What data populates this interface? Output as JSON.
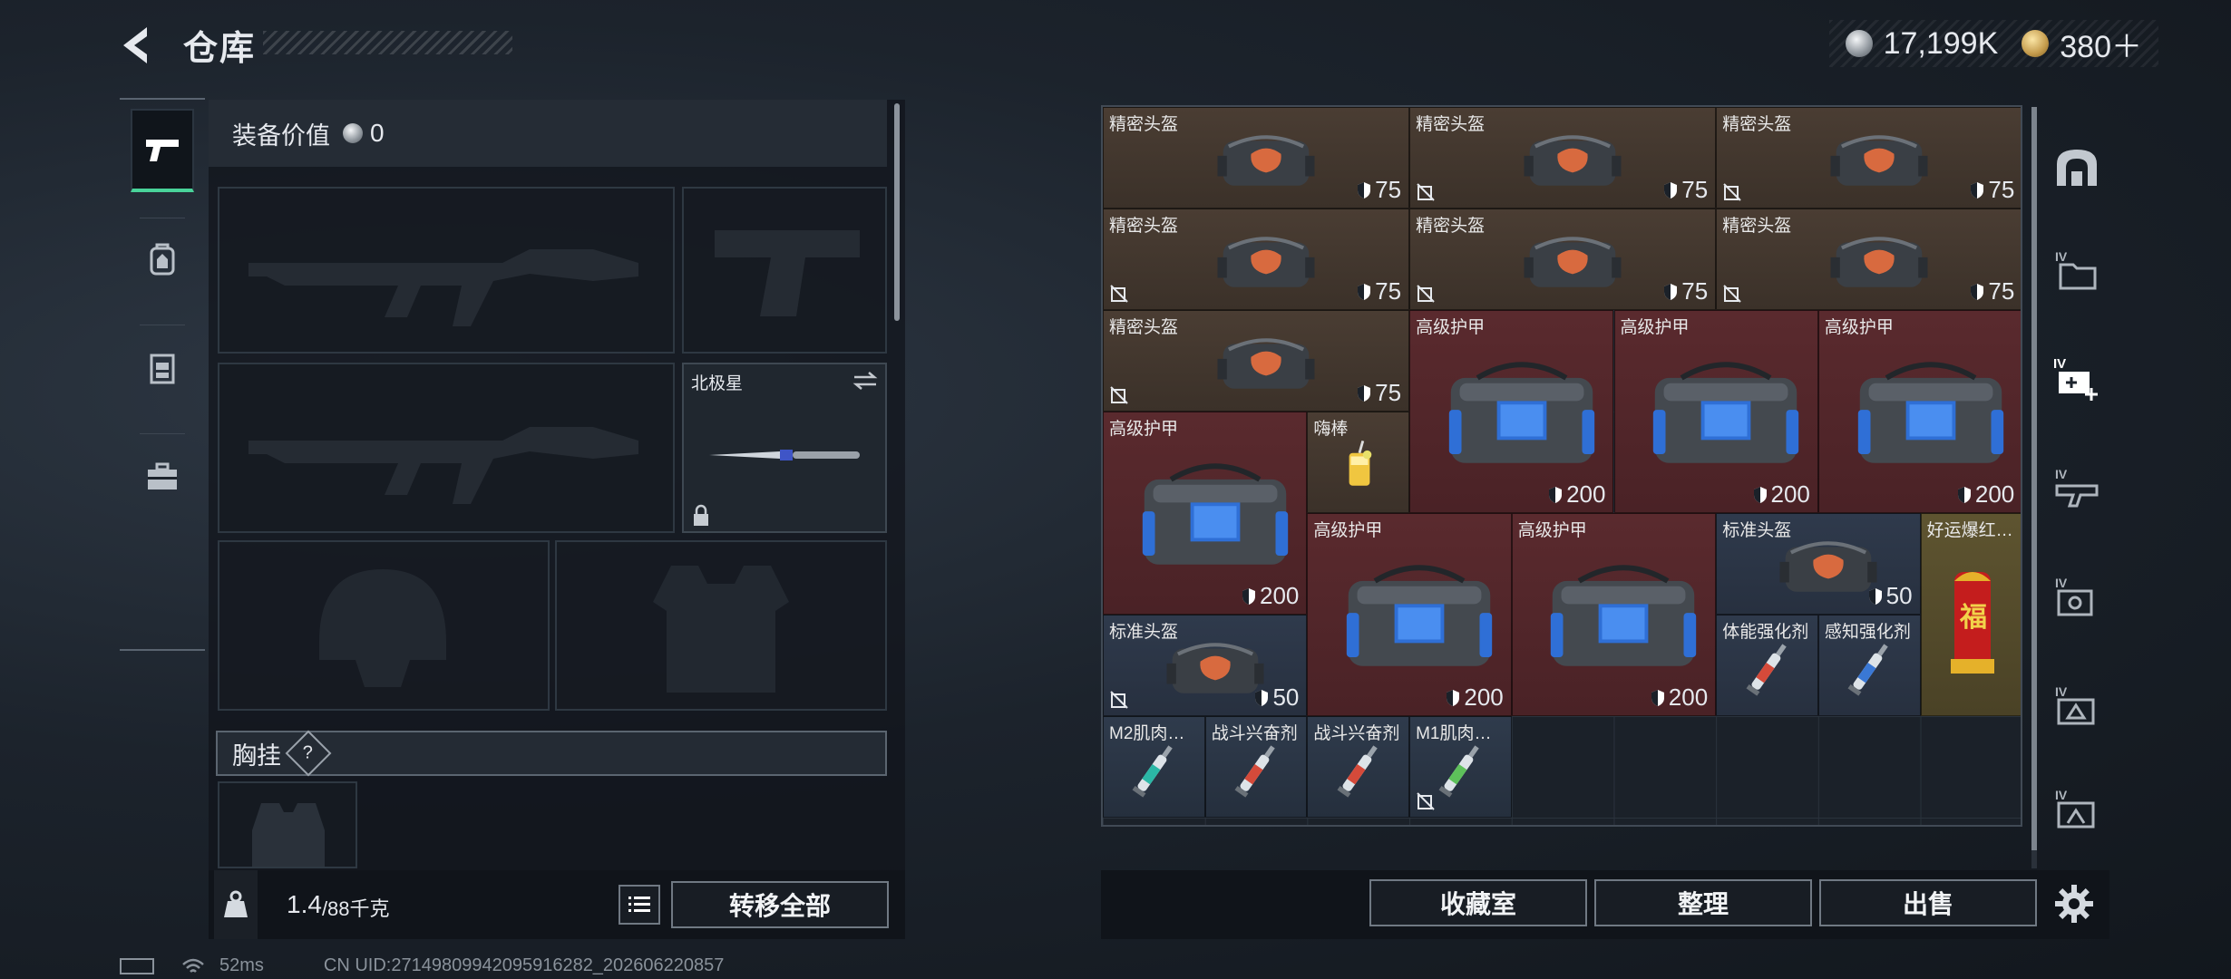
{
  "header": {
    "title": "仓库",
    "currency_silver": "17,199K",
    "currency_gold": "380＋"
  },
  "left_rail": {
    "items": [
      "pistol-icon",
      "backpack-icon",
      "chest-rig-icon",
      "toolbox-icon"
    ]
  },
  "equip": {
    "value_label": "装备价值",
    "value": "0",
    "melee_name": "北极星"
  },
  "vest": {
    "label": "胸挂",
    "help": "?"
  },
  "footer_left": {
    "weight_current": "1.4",
    "weight_max": "/88千克",
    "transfer_all": "转移全部"
  },
  "footer_right": {
    "collection": "收藏室",
    "sort": "整理",
    "sell": "出售"
  },
  "status": {
    "ping": "52ms",
    "uid": "CN UID:27149809942095916282_202606220857"
  },
  "items": [
    {
      "name": "精密头盔",
      "dur": "75"
    },
    {
      "name": "精密头盔",
      "dur": "75"
    },
    {
      "name": "精密头盔",
      "dur": "75"
    },
    {
      "name": "精密头盔",
      "dur": "75"
    },
    {
      "name": "精密头盔",
      "dur": "75"
    },
    {
      "name": "精密头盔",
      "dur": "75"
    },
    {
      "name": "精密头盔",
      "dur": "75"
    },
    {
      "name": "高级护甲",
      "dur": "200"
    },
    {
      "name": "高级护甲",
      "dur": "200"
    },
    {
      "name": "高级护甲",
      "dur": "200"
    },
    {
      "name": "高级护甲",
      "dur": "200"
    },
    {
      "name": "嗨棒",
      "dur": ""
    },
    {
      "name": "高级护甲",
      "dur": "200"
    },
    {
      "name": "高级护甲",
      "dur": "200"
    },
    {
      "name": "标准头盔",
      "dur": "50"
    },
    {
      "name": "好运爆红…",
      "dur": ""
    },
    {
      "name": "标准头盔",
      "dur": "50"
    },
    {
      "name": "体能强化剂",
      "dur": ""
    },
    {
      "name": "感知强化剂",
      "dur": ""
    },
    {
      "name": "M2肌肉…",
      "dur": ""
    },
    {
      "name": "战斗兴奋剂",
      "dur": ""
    },
    {
      "name": "战斗兴奋剂",
      "dur": ""
    },
    {
      "name": "M1肌肉…",
      "dur": ""
    }
  ]
}
